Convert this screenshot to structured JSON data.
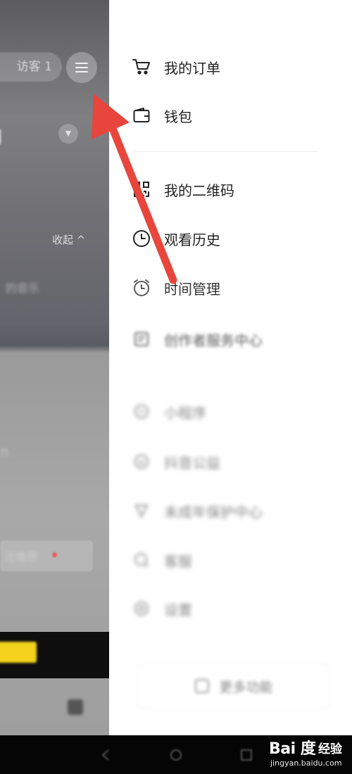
{
  "background": {
    "visitor_pill": "访客 1",
    "collapse_label": "收起 ^",
    "blur_text_1": "的音乐",
    "blur_text_2": "n",
    "blur_text_3": "注推荐"
  },
  "drawer": {
    "items": [
      {
        "label": "我的订单",
        "icon": "cart-icon"
      },
      {
        "label": "钱包",
        "icon": "wallet-icon"
      },
      {
        "label": "我的二维码",
        "icon": "qrcode-icon"
      },
      {
        "label": "观看历史",
        "icon": "clock-icon"
      },
      {
        "label": "时间管理",
        "icon": "alarm-icon"
      },
      {
        "label": "创作者服务中心",
        "icon": "document-icon"
      },
      {
        "label": "小程序",
        "icon": "miniapp-icon"
      },
      {
        "label": "抖音公益",
        "icon": "charity-icon"
      },
      {
        "label": "未成年保护中心",
        "icon": "shield-icon"
      },
      {
        "label": "客服",
        "icon": "headset-icon"
      },
      {
        "label": "设置",
        "icon": "gear-icon"
      }
    ],
    "more_button": "更多功能"
  },
  "watermark": {
    "brand": "Bai 度",
    "suffix": "经验",
    "url": "jingyan.baidu.com"
  },
  "colors": {
    "annotation_arrow": "#e8453c",
    "drawer_bg": "#ffffff"
  }
}
